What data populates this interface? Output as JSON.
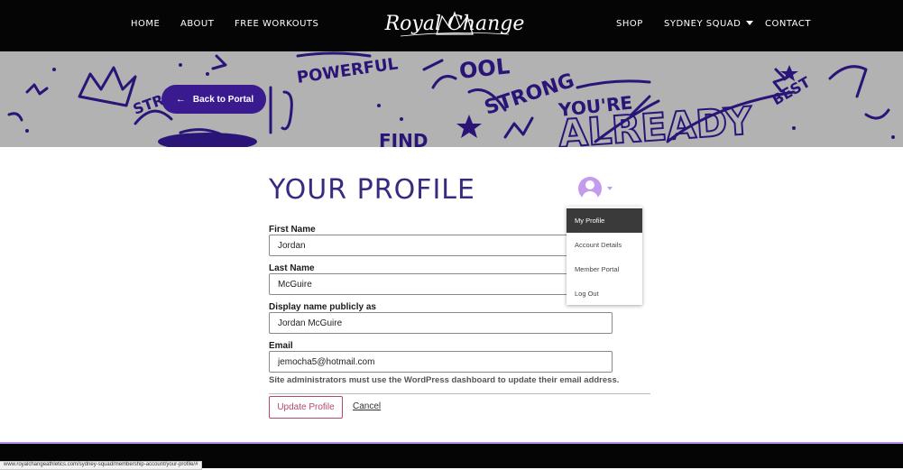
{
  "nav": {
    "home": "HOME",
    "about": "ABOUT",
    "free_workouts": "FREE WORKOUTS",
    "logo": "Royal Change",
    "shop": "SHOP",
    "sydney_squad": "SYDNEY SQUAD",
    "contact": "CONTACT"
  },
  "banner": {
    "back_button": "Back to Portal"
  },
  "profile": {
    "title": "YOUR PROFILE",
    "first_name_label": "First Name",
    "first_name_value": "Jordan",
    "last_name_label": "Last Name",
    "last_name_value": "McGuire",
    "display_name_label": "Display name publicly as",
    "display_name_value": "Jordan McGuire",
    "email_label": "Email",
    "email_value": "jemocha5@hotmail.com",
    "email_hint": "Site administrators must use the WordPress dashboard to update their email address.",
    "update_button": "Update Profile",
    "cancel_link": "Cancel"
  },
  "account_menu": {
    "items": [
      "My Profile",
      "Account Details",
      "Member Portal",
      "Log Out"
    ],
    "active_index": 0
  },
  "status_bar": {
    "url": "www.royalchangeathletics.com/sydney-squad/membership-account/your-profile/#"
  },
  "colors": {
    "nav_bg": "#050505",
    "brand_purple": "#3a1a8f",
    "title_purple": "#3a2a7f",
    "avatar_lilac": "#c49aec",
    "update_accent": "#b24a6e"
  }
}
